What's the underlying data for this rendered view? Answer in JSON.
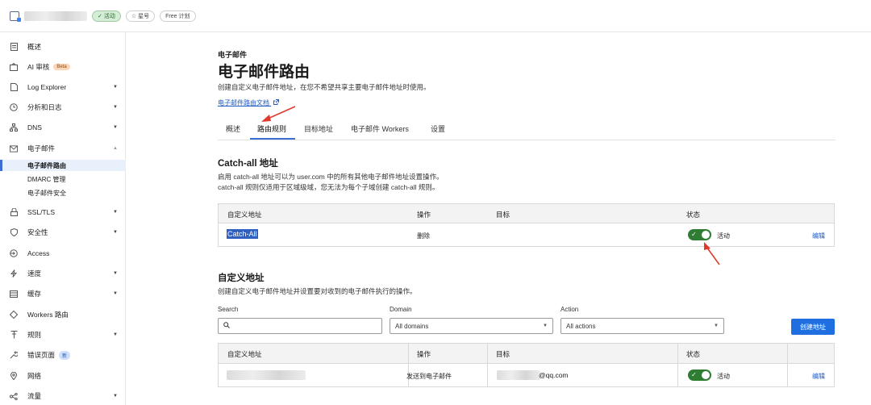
{
  "topbar": {
    "status": "活动",
    "star": "星号",
    "plan": "Free 计划"
  },
  "sidebar": {
    "items": [
      {
        "label": "概述",
        "icon": "document-icon"
      },
      {
        "label": "AI 审核",
        "icon": "ai-audit-icon",
        "badge": "Beta"
      },
      {
        "label": "Log Explorer",
        "icon": "log-icon"
      },
      {
        "label": "分析和日志",
        "icon": "clock-icon"
      },
      {
        "label": "DNS",
        "icon": "network-icon"
      },
      {
        "label": "电子邮件",
        "icon": "mail-icon"
      },
      {
        "label": "SSL/TLS",
        "icon": "lock-icon"
      },
      {
        "label": "安全性",
        "icon": "shield-icon"
      },
      {
        "label": "Access",
        "icon": "access-icon"
      },
      {
        "label": "速度",
        "icon": "bolt-icon"
      },
      {
        "label": "缓存",
        "icon": "cache-icon"
      },
      {
        "label": "Workers 路由",
        "icon": "workers-icon"
      },
      {
        "label": "规则",
        "icon": "rules-icon"
      },
      {
        "label": "错误页面",
        "icon": "wrench-icon",
        "badge": "新"
      },
      {
        "label": "网络",
        "icon": "location-icon"
      },
      {
        "label": "流量",
        "icon": "traffic-icon"
      }
    ],
    "email_sub": [
      "电子邮件路由",
      "DMARC 管理",
      "电子邮件安全"
    ]
  },
  "header": {
    "eyebrow": "电子邮件",
    "title": "电子邮件路由",
    "description": "创建自定义电子邮件地址，在您不希望共享主要电子邮件地址时使用。",
    "doc_link": "电子邮件路由文档"
  },
  "tabs": [
    "概述",
    "路由规则",
    "目标地址",
    "电子邮件 Workers",
    "设置"
  ],
  "catchall": {
    "title": "Catch-all 地址",
    "desc1": "启用 catch-all 地址可以为 user.com 中的所有其他电子邮件地址设置操作。",
    "desc2": "catch-all 规则仅适用于区域级域，您无法为每个子域创建 catch-all 规则。",
    "headers": [
      "自定义地址",
      "操作",
      "目标",
      "状态"
    ],
    "row": {
      "address": "Catch-All",
      "action": "删除",
      "status": "活动",
      "edit": "编辑"
    }
  },
  "custom": {
    "title": "自定义地址",
    "desc": "创建自定义电子邮件地址并设置要对收到的电子邮件执行的操作。",
    "search_label": "Search",
    "domain_label": "Domain",
    "domain_value": "All domains",
    "action_label": "Action",
    "action_value": "All actions",
    "create_button": "创建地址",
    "headers": [
      "自定义地址",
      "操作",
      "目标",
      "状态"
    ],
    "row": {
      "action": "发送到电子邮件",
      "target_suffix": "@qq.com",
      "status": "活动",
      "edit": "编辑"
    }
  }
}
